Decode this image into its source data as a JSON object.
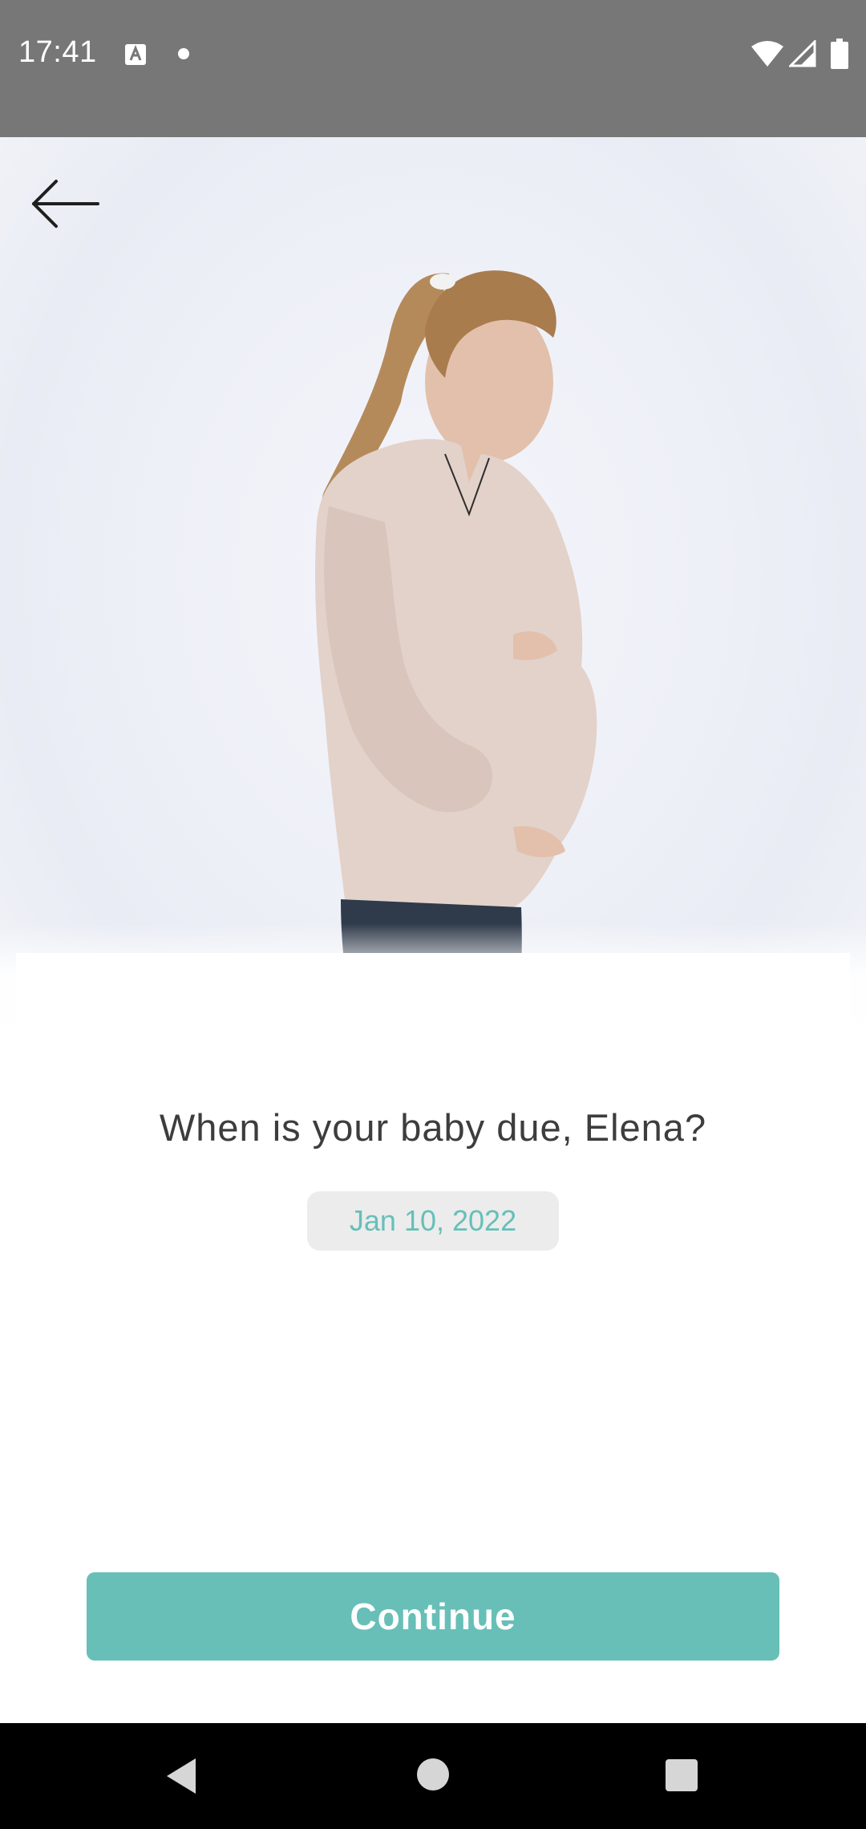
{
  "status_bar": {
    "time": "17:41",
    "icons": [
      "text-a-icon",
      "dot-icon",
      "wifi-icon",
      "signal-icon",
      "battery-icon"
    ]
  },
  "hero": {
    "image": "pregnant-woman-photo",
    "back_icon": "arrow-left-icon"
  },
  "main": {
    "question": "When is your baby due, Elena?",
    "due_date": "Jan 10, 2022",
    "continue_label": "Continue"
  },
  "nav_bar": {
    "icons": [
      "nav-back-icon",
      "nav-home-icon",
      "nav-recents-icon"
    ]
  },
  "colors": {
    "accent": "#67bfb8",
    "status_bar": "#777777",
    "chip_bg": "#ececec",
    "text": "#3d3d3d"
  }
}
